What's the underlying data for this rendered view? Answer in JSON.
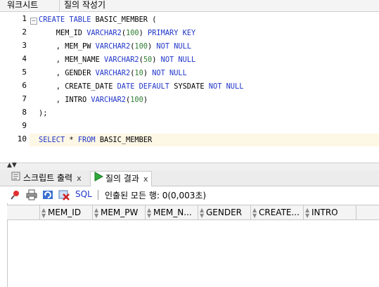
{
  "top_tabs": [
    {
      "label": "워크시트"
    },
    {
      "label": "질의 작성기"
    }
  ],
  "editor": {
    "line_numbers": [
      "1",
      "2",
      "3",
      "4",
      "5",
      "6",
      "7",
      "8",
      "9",
      "10"
    ],
    "fold_marker": "−",
    "lines": [
      [
        {
          "t": "CREATE TABLE",
          "c": "kw"
        },
        {
          "t": " BASIC_MEMBER (",
          "c": "id"
        }
      ],
      [
        {
          "t": "    MEM_ID ",
          "c": "id"
        },
        {
          "t": "VARCHAR2",
          "c": "ty"
        },
        {
          "t": "(",
          "c": "id"
        },
        {
          "t": "100",
          "c": "num"
        },
        {
          "t": ") ",
          "c": "id"
        },
        {
          "t": "PRIMARY KEY",
          "c": "kw"
        }
      ],
      [
        {
          "t": "    , MEM_PW ",
          "c": "id"
        },
        {
          "t": "VARCHAR2",
          "c": "ty"
        },
        {
          "t": "(",
          "c": "id"
        },
        {
          "t": "100",
          "c": "num"
        },
        {
          "t": ") ",
          "c": "id"
        },
        {
          "t": "NOT NULL",
          "c": "kw"
        }
      ],
      [
        {
          "t": "    , MEM_NAME ",
          "c": "id"
        },
        {
          "t": "VARCHAR2",
          "c": "ty"
        },
        {
          "t": "(",
          "c": "id"
        },
        {
          "t": "50",
          "c": "num"
        },
        {
          "t": ") ",
          "c": "id"
        },
        {
          "t": "NOT NULL",
          "c": "kw"
        }
      ],
      [
        {
          "t": "    , GENDER ",
          "c": "id"
        },
        {
          "t": "VARCHAR2",
          "c": "ty"
        },
        {
          "t": "(",
          "c": "id"
        },
        {
          "t": "10",
          "c": "num"
        },
        {
          "t": ") ",
          "c": "id"
        },
        {
          "t": "NOT NULL",
          "c": "kw"
        }
      ],
      [
        {
          "t": "    , CREATE_DATE ",
          "c": "id"
        },
        {
          "t": "DATE DEFAULT",
          "c": "kw"
        },
        {
          "t": " SYSDATE ",
          "c": "id"
        },
        {
          "t": "NOT NULL",
          "c": "kw"
        }
      ],
      [
        {
          "t": "    , INTRO ",
          "c": "id"
        },
        {
          "t": "VARCHAR2",
          "c": "ty"
        },
        {
          "t": "(",
          "c": "id"
        },
        {
          "t": "100",
          "c": "num"
        },
        {
          "t": ")",
          "c": "id"
        }
      ],
      [
        {
          "t": ");",
          "c": "id"
        }
      ],
      [],
      [
        {
          "t": "SELECT",
          "c": "kw"
        },
        {
          "t": " * ",
          "c": "id"
        },
        {
          "t": "FROM",
          "c": "kw"
        },
        {
          "t": " BASIC_MEMBER",
          "c": "id"
        }
      ]
    ],
    "active_line": 10
  },
  "lower_tabs": [
    {
      "label": "스크립트 출력",
      "icon": "script-output-icon",
      "close": "x"
    },
    {
      "label": "질의 결과",
      "icon": "run-triangle-icon",
      "close": "x"
    }
  ],
  "toolbar": {
    "icons": [
      "pin-icon",
      "print-icon",
      "refresh-icon",
      "delete-icon"
    ],
    "sql_label": "SQL",
    "separator": "|",
    "status": "인출된 모든 행: 0(0,003초)"
  },
  "grid": {
    "columns": [
      "MEM_ID",
      "MEM_PW",
      "MEM_N...",
      "GENDER",
      "CREATE...",
      "INTRO"
    ],
    "rows": []
  },
  "colors": {
    "keyword": "#2035c8",
    "number": "#2e7d32",
    "active_line_bg": "#fdf7e5"
  }
}
